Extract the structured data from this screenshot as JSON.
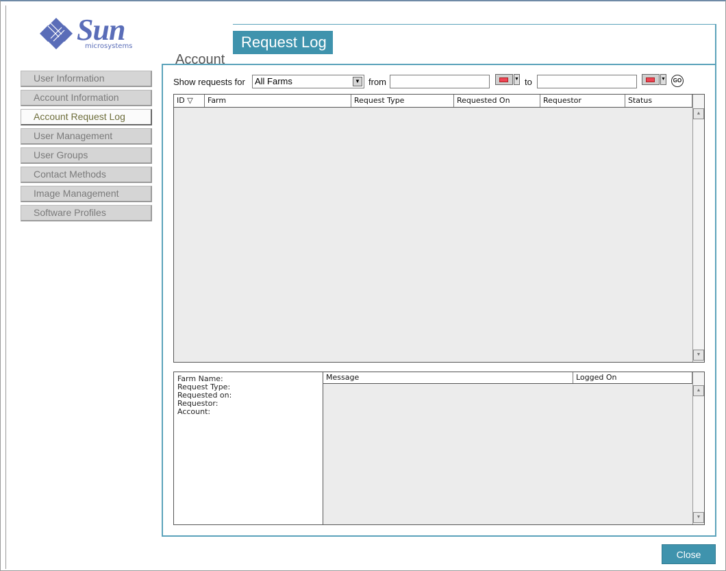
{
  "brand": {
    "wordmark": "Sun",
    "subtitle": "microsystems",
    "color": "#5a6db8"
  },
  "sidebar": {
    "items": [
      {
        "label": "User Information",
        "active": false
      },
      {
        "label": "Account Information",
        "active": false
      },
      {
        "label": "Account Request Log",
        "active": true
      },
      {
        "label": "User Management",
        "active": false
      },
      {
        "label": "User Groups",
        "active": false
      },
      {
        "label": "Contact Methods",
        "active": false
      },
      {
        "label": "Image Management",
        "active": false
      },
      {
        "label": "Software Profiles",
        "active": false
      }
    ]
  },
  "tabs": {
    "plain": "Account",
    "active": "Request Log",
    "accent": "#3f93ad"
  },
  "filter": {
    "show_label": "Show requests for",
    "farm_selected": "All Farms",
    "from_label": "from",
    "from_value": "",
    "to_label": "to",
    "to_value": "",
    "go_label": "GO"
  },
  "requests_table": {
    "columns": [
      "ID",
      "Farm",
      "Request Type",
      "Requested On",
      "Requestor",
      "Status"
    ],
    "sort_indicator": "▽",
    "rows": []
  },
  "details": {
    "fields": [
      "Farm Name:",
      "Request Type:",
      "Requested on:",
      "Requestor:",
      "Account:"
    ]
  },
  "messages_table": {
    "columns": [
      "Message",
      "Logged On"
    ],
    "rows": []
  },
  "footer": {
    "close_label": "Close"
  }
}
